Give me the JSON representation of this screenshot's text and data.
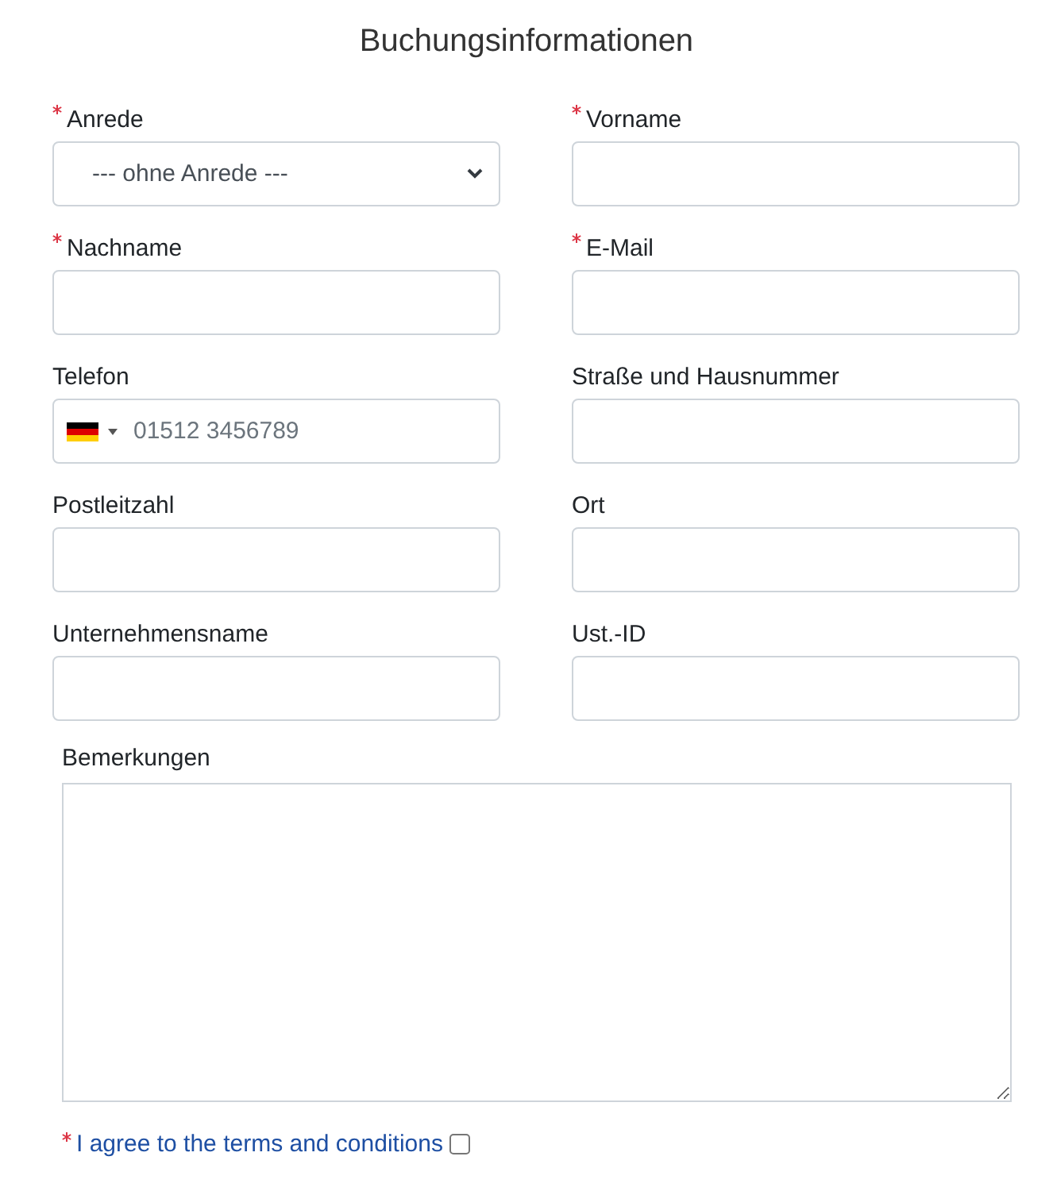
{
  "title": "Buchungsinformationen",
  "fields": [
    {
      "label": "Anrede",
      "required": true,
      "kind": "select",
      "value": "--- ohne Anrede ---"
    },
    {
      "label": "Vorname",
      "required": true,
      "kind": "text"
    },
    {
      "label": "Nachname",
      "required": true,
      "kind": "text"
    },
    {
      "label": "E-Mail",
      "required": true,
      "kind": "text"
    },
    {
      "label": "Telefon",
      "required": false,
      "kind": "phone",
      "placeholder": "01512 3456789"
    },
    {
      "label": "Straße und Hausnummer",
      "required": false,
      "kind": "text"
    },
    {
      "label": "Postleitzahl",
      "required": false,
      "kind": "text"
    },
    {
      "label": "Ort",
      "required": false,
      "kind": "text"
    },
    {
      "label": "Unternehmensname",
      "required": false,
      "kind": "text"
    },
    {
      "label": "Ust.-ID",
      "required": false,
      "kind": "text"
    }
  ],
  "remarks": {
    "label": "Bemerkungen"
  },
  "agree": {
    "label": "I agree to the terms and conditions",
    "required": true,
    "checked": false
  }
}
